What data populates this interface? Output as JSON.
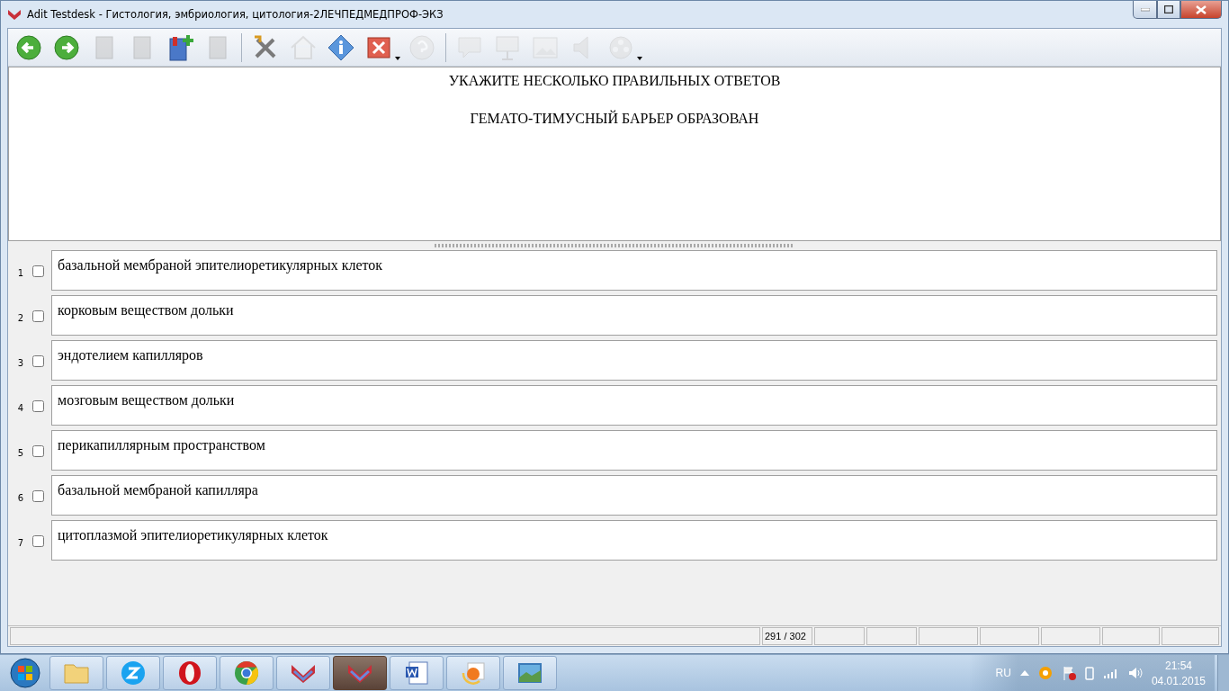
{
  "window": {
    "title": "Adit Testdesk - Гистология, эмбриология, цитология-2ЛЕЧПЕДМЕДПРОФ-ЭКЗ"
  },
  "toolbar": [
    {
      "kind": "back",
      "disabled": false
    },
    {
      "kind": "forward",
      "disabled": false
    },
    {
      "kind": "book-prev",
      "disabled": true
    },
    {
      "kind": "book-next",
      "disabled": true
    },
    {
      "kind": "book-add",
      "disabled": false
    },
    {
      "kind": "book",
      "disabled": true
    },
    {
      "kind": "sep"
    },
    {
      "kind": "tools",
      "disabled": false
    },
    {
      "kind": "home",
      "disabled": true
    },
    {
      "kind": "info",
      "disabled": false
    },
    {
      "kind": "close",
      "disabled": false,
      "dropdown": true
    },
    {
      "kind": "help",
      "disabled": true
    },
    {
      "kind": "sep"
    },
    {
      "kind": "bubble",
      "disabled": true
    },
    {
      "kind": "presentation",
      "disabled": true
    },
    {
      "kind": "image",
      "disabled": true
    },
    {
      "kind": "speaker",
      "disabled": true
    },
    {
      "kind": "film",
      "disabled": true,
      "dropdown": true
    }
  ],
  "question": {
    "instruction": "УКАЖИТЕ НЕСКОЛЬКО ПРАВИЛЬНЫХ ОТВЕТОВ",
    "text": "ГЕМАТО-ТИМУСНЫЙ БАРЬЕР ОБРАЗОВАН"
  },
  "answers": [
    {
      "number": "1",
      "checked": false,
      "text": "базальной мембраной эпителиоретикулярных клеток"
    },
    {
      "number": "2",
      "checked": false,
      "text": "корковым веществом дольки"
    },
    {
      "number": "3",
      "checked": false,
      "text": "эндотелием капилляров"
    },
    {
      "number": "4",
      "checked": false,
      "text": "мозговым веществом дольки"
    },
    {
      "number": "5",
      "checked": false,
      "text": "перикапиллярным пространством"
    },
    {
      "number": "6",
      "checked": false,
      "text": "базальной мембраной капилляра"
    },
    {
      "number": "7",
      "checked": false,
      "text": "цитоплазмой эпителиоретикулярных клеток"
    }
  ],
  "status_bar": {
    "counter": "291 / 302"
  },
  "taskbar": {
    "apps": [
      {
        "kind": "folder",
        "selected": false
      },
      {
        "kind": "z",
        "selected": false
      },
      {
        "kind": "opera",
        "selected": false
      },
      {
        "kind": "chrome",
        "selected": false
      },
      {
        "kind": "testdesk",
        "selected": false
      },
      {
        "kind": "testdesk",
        "selected": true
      },
      {
        "kind": "word",
        "selected": false
      },
      {
        "kind": "photo",
        "selected": false
      },
      {
        "kind": "picture",
        "selected": false
      }
    ],
    "language": "RU",
    "time": "21:54",
    "date": "04.01.2015"
  }
}
